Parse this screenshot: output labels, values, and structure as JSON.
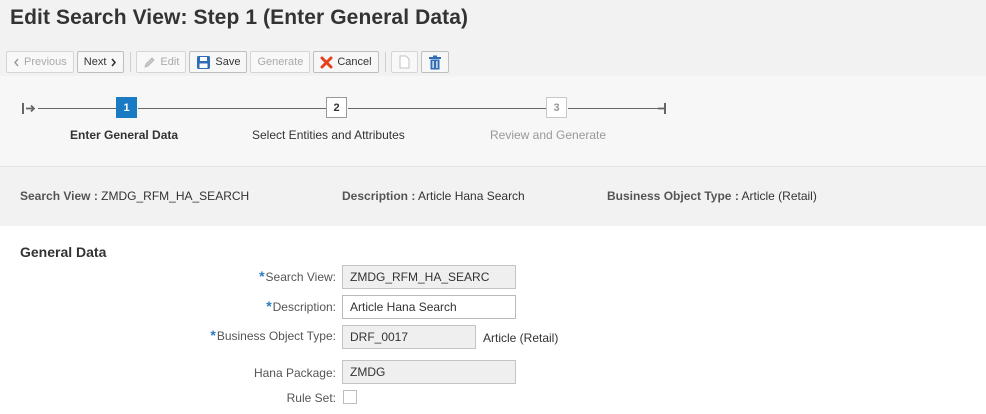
{
  "page_title": "Edit Search View: Step 1  (Enter General Data)",
  "toolbar": {
    "previous": "Previous",
    "next": "Next",
    "edit": "Edit",
    "save": "Save",
    "generate": "Generate",
    "cancel": "Cancel"
  },
  "roadmap": {
    "steps": [
      {
        "number": "1",
        "label": "Enter General Data",
        "state": "active"
      },
      {
        "number": "2",
        "label": "Select Entities and Attributes",
        "state": "normal"
      },
      {
        "number": "3",
        "label": "Review and Generate",
        "state": "disabled"
      }
    ]
  },
  "info": {
    "search_view_label": "Search View :",
    "search_view_value": "ZMDG_RFM_HA_SEARCH",
    "description_label": "Description :",
    "description_value": "Article Hana Search",
    "bo_type_label": "Business Object Type :",
    "bo_type_value": "Article (Retail)"
  },
  "general": {
    "title": "General Data",
    "fields": {
      "search_view": {
        "label": "Search View:",
        "value": "ZMDG_RFM_HA_SEARC"
      },
      "description": {
        "label": "Description:",
        "value": "Article Hana Search"
      },
      "bo_type": {
        "label": "Business Object Type:",
        "value": "DRF_0017",
        "text": "Article (Retail)"
      },
      "hana_package": {
        "label": "Hana Package:",
        "value": "ZMDG"
      },
      "rule_set": {
        "label": "Rule Set:"
      }
    },
    "required_marker": "*"
  },
  "colors": {
    "accent": "#1a7ac4",
    "cancel_icon": "#e8401c",
    "save_icon": "#2e6db4"
  }
}
